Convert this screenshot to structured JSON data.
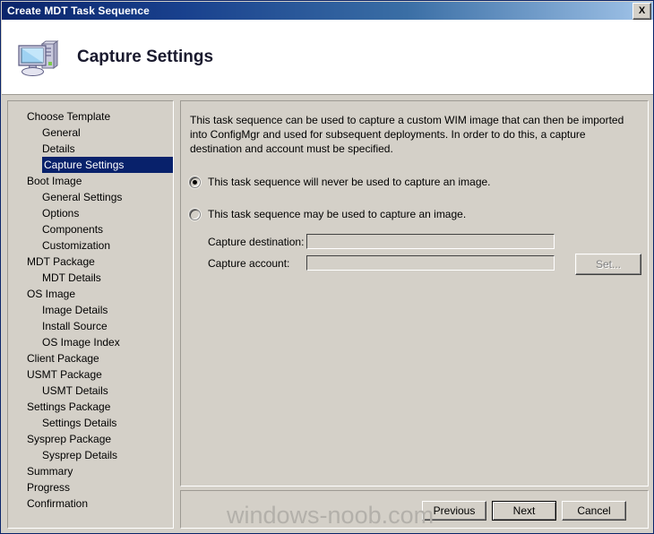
{
  "window": {
    "title": "Create MDT Task Sequence",
    "close_label": "X"
  },
  "header": {
    "icon": "computer-icon",
    "title": "Capture Settings"
  },
  "sidebar": {
    "items": [
      {
        "label": "Choose Template",
        "indent": false,
        "selected": false
      },
      {
        "label": "General",
        "indent": true,
        "selected": false
      },
      {
        "label": "Details",
        "indent": true,
        "selected": false
      },
      {
        "label": "Capture Settings",
        "indent": true,
        "selected": true
      },
      {
        "label": "Boot Image",
        "indent": false,
        "selected": false
      },
      {
        "label": "General Settings",
        "indent": true,
        "selected": false
      },
      {
        "label": "Options",
        "indent": true,
        "selected": false
      },
      {
        "label": "Components",
        "indent": true,
        "selected": false
      },
      {
        "label": "Customization",
        "indent": true,
        "selected": false
      },
      {
        "label": "MDT Package",
        "indent": false,
        "selected": false
      },
      {
        "label": "MDT Details",
        "indent": true,
        "selected": false
      },
      {
        "label": "OS Image",
        "indent": false,
        "selected": false
      },
      {
        "label": "Image Details",
        "indent": true,
        "selected": false
      },
      {
        "label": "Install Source",
        "indent": true,
        "selected": false
      },
      {
        "label": "OS Image Index",
        "indent": true,
        "selected": false
      },
      {
        "label": "Client Package",
        "indent": false,
        "selected": false
      },
      {
        "label": "USMT Package",
        "indent": false,
        "selected": false
      },
      {
        "label": "USMT Details",
        "indent": true,
        "selected": false
      },
      {
        "label": "Settings Package",
        "indent": false,
        "selected": false
      },
      {
        "label": "Settings Details",
        "indent": true,
        "selected": false
      },
      {
        "label": "Sysprep Package",
        "indent": false,
        "selected": false
      },
      {
        "label": "Sysprep Details",
        "indent": true,
        "selected": false
      },
      {
        "label": "Summary",
        "indent": false,
        "selected": false
      },
      {
        "label": "Progress",
        "indent": false,
        "selected": false
      },
      {
        "label": "Confirmation",
        "indent": false,
        "selected": false
      }
    ]
  },
  "content": {
    "description": "This task sequence can be used to capture a custom WIM image that can then be imported into ConfigMgr and used for subsequent deployments.  In order to do this, a capture destination and account must be specified.",
    "radio_never": {
      "label": "This task sequence will never be used to capture an image.",
      "checked": true
    },
    "radio_may": {
      "label": "This task sequence may be used to capture an image.",
      "checked": false
    },
    "capture_destination": {
      "label": "Capture destination:",
      "value": "",
      "placeholder": ""
    },
    "capture_account": {
      "label": "Capture account:",
      "value": "",
      "placeholder": ""
    },
    "set_button": "Set..."
  },
  "footer": {
    "previous": "Previous",
    "next": "Next",
    "cancel": "Cancel"
  },
  "watermark": "windows-noob.com",
  "colors": {
    "dialog_face": "#d4d0c8",
    "titlebar_start": "#0a246a",
    "titlebar_end": "#a6c8ec",
    "selection": "#08216b",
    "disabled_text": "#808080",
    "watermark": "#b3b0aa"
  }
}
